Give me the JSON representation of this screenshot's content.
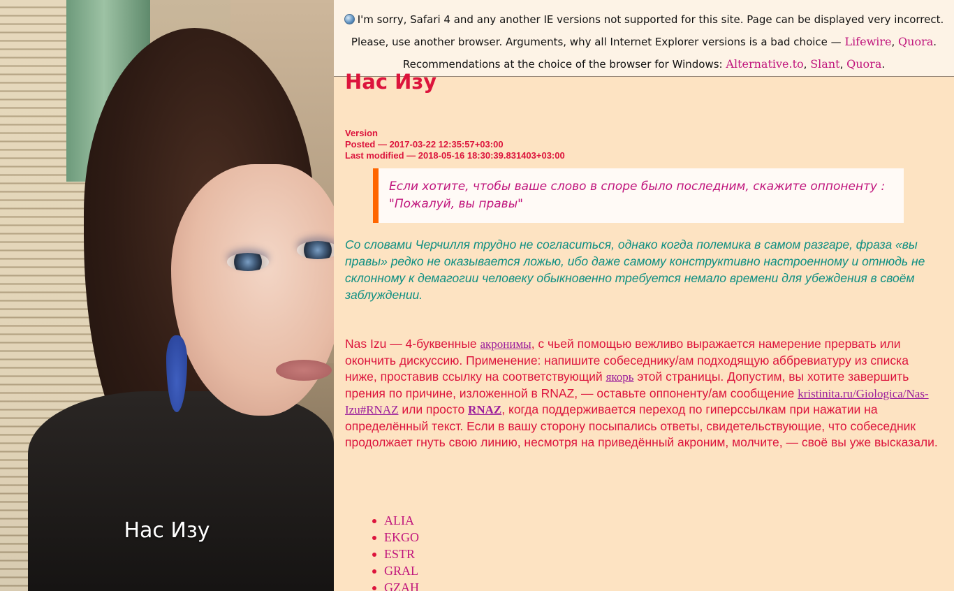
{
  "photo": {
    "caption": "Нас Изу"
  },
  "banner": {
    "line1": "I'm sorry, Safari 4 and any another IE versions not supported for this site. Page can be displayed very incorrect.",
    "line2_prefix": "Please, use another browser. Arguments, why all Internet Explorer versions is a bad choice — ",
    "link_lifewire": "Lifewire",
    "link_quora1": "Quora",
    "line3_prefix": "Recommendations at the choice of the browser for Windows: ",
    "link_alternative": "Alternative.to",
    "link_slant": "Slant",
    "link_quora2": "Quora",
    "sep_comma": ", ",
    "end_dot": "."
  },
  "article": {
    "title": "Нас Изу",
    "version_label": "Version",
    "posted": "Posted — 2017-03-22 12:35:57+03:00",
    "modified": "Last modified — 2018-05-16 18:30:39.831403+03:00",
    "quote": "Если хотите, чтобы ваше слово в споре было последним, скажите оппоненту : \"Пожалуй, вы правы\"",
    "lead": "Со словами Черчилля трудно не согласиться, однако когда полемика в самом разгаре, фраза «вы правы» редко не оказывается ложью, ибо даже самому конструктивно настроенному и отнюдь не склонному к демагогии человеку обыкновенно требуется немало времени для убеждения в своём заблуждении.",
    "body": {
      "p1": "Nas Izu — 4-буквенные ",
      "link_acronyms": "акронимы",
      "p2": ", с чьей помощью вежливо выражается намерение прервать или окончить дискуссию. Применение: напишите собеседнику/ам подходящую аббревиатуру из списка ниже, проставив ссылку на соответствующий ",
      "link_anchor": "якорь",
      "p3": " этой страницы. Допустим, вы хотите завершить прения по причине, изложенной в RNAZ, — оставьте оппоненту/ам сообщение ",
      "link_url": "kristinita.ru/Giologica/Nas-Izu#RNAZ",
      "p4": " или просто ",
      "link_rnaz": "RNAZ",
      "p5": ", когда поддерживается переход по гиперссылкам при нажатии на определённый текст. Если в вашу сторону посыпались ответы, свидетельствующие, что собеседник продолжает гнуть свою линию, несмотря на приведённый акроним, молчите, — своё вы уже высказали."
    },
    "acronyms": [
      "ALIA",
      "EKGO",
      "ESTR",
      "GRAL",
      "GZAH"
    ]
  },
  "colors": {
    "crimson": "#dc143c",
    "magenta": "#c0147c",
    "teal": "#0f8f82",
    "orange": "#ff6600",
    "background": "#fde3c2"
  }
}
